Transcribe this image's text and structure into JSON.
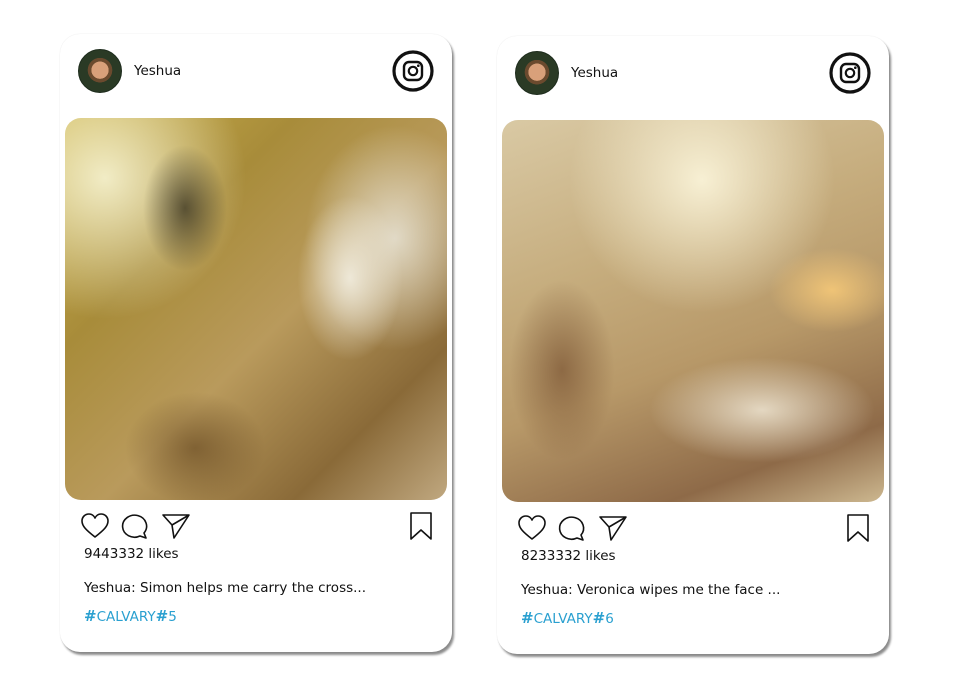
{
  "posts": [
    {
      "username": "Yeshua",
      "likes_text": "9443332 likes",
      "caption": "Yeshua: Simon helps me carry the cross...",
      "hashtag_symbol_1": "#",
      "hashtag_word": "CALVARY",
      "hashtag_symbol_2": "#",
      "hashtag_number": "5"
    },
    {
      "username": "Yeshua",
      "likes_text": "8233332 likes",
      "caption": "Yeshua: Veronica wipes me the face ...",
      "hashtag_symbol_1": "#",
      "hashtag_word": "CALVARY",
      "hashtag_symbol_2": "#",
      "hashtag_number": "6"
    }
  ],
  "icons": {
    "app": "instagram-icon",
    "like": "heart-icon",
    "comment": "comment-icon",
    "share": "share-icon",
    "save": "bookmark-icon"
  },
  "colors": {
    "hashtag": "#2aa0d0",
    "text": "#111111",
    "card_background": "#ffffff"
  }
}
